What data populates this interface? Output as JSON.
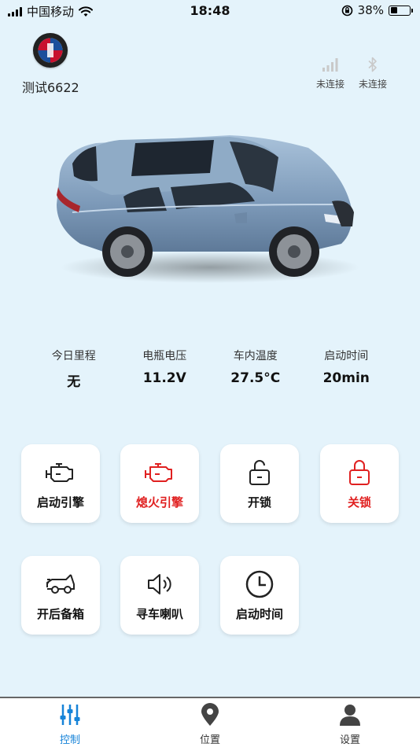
{
  "status_bar": {
    "carrier": "中国移动",
    "time": "18:48",
    "battery": "38%",
    "battery_level": 0.38
  },
  "header": {
    "logo_text": "ALPINA",
    "device_name": "测试6622",
    "connections": [
      {
        "icon": "signal-bars-icon",
        "status": "未连接"
      },
      {
        "icon": "bluetooth-icon",
        "status": "未连接"
      }
    ]
  },
  "stats": [
    {
      "label": "今日里程",
      "value": "无"
    },
    {
      "label": "电瓶电压",
      "value": "11.2V"
    },
    {
      "label": "车内温度",
      "value": "27.5°C"
    },
    {
      "label": "启动时间",
      "value": "20min"
    }
  ],
  "controls": {
    "start_engine": "启动引擎",
    "stop_engine": "熄火引擎",
    "unlock": "开锁",
    "lock": "关锁",
    "open_trunk": "开后备箱",
    "find_car": "寻车喇叭",
    "start_time": "启动时间"
  },
  "tabs": {
    "control": "控制",
    "location": "位置",
    "settings": "设置"
  },
  "colors": {
    "background": "#e4f3fb",
    "accent": "#1683d8",
    "danger": "#e02020"
  }
}
